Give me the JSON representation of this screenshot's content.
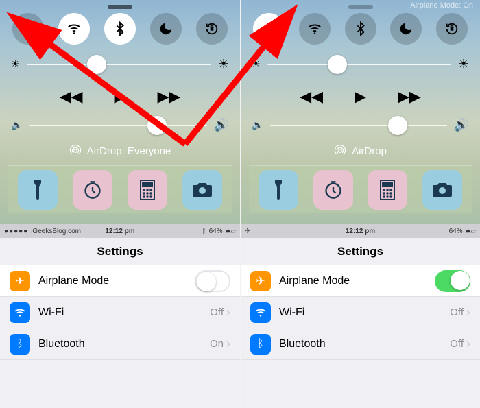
{
  "left": {
    "mode_banner": "",
    "toggles": {
      "airplane_on": false,
      "wifi_on": true,
      "bluetooth_on": true,
      "dnd_on": false,
      "lock_on": false
    },
    "brightness_pct": 38,
    "volume_pct": 72,
    "airdrop_label": "AirDrop: Everyone",
    "statusbar": {
      "carrier": "iGeeksBlog.com",
      "time": "12:12 pm",
      "battery": "64%",
      "airplane_icon": false,
      "show_bt": true
    },
    "settings_title": "Settings",
    "rows": {
      "airplane": {
        "label": "Airplane Mode",
        "switch_on": false
      },
      "wifi": {
        "label": "Wi-Fi",
        "value": "Off"
      },
      "bt": {
        "label": "Bluetooth",
        "value": "On"
      }
    }
  },
  "right": {
    "mode_banner": "Airplane Mode: On",
    "toggles": {
      "airplane_on": true,
      "wifi_on": false,
      "bluetooth_on": false,
      "dnd_on": false,
      "lock_on": false
    },
    "brightness_pct": 38,
    "volume_pct": 72,
    "airdrop_label": "AirDrop",
    "statusbar": {
      "carrier": "",
      "time": "12:12 pm",
      "battery": "64%",
      "airplane_icon": true,
      "show_bt": false
    },
    "settings_title": "Settings",
    "rows": {
      "airplane": {
        "label": "Airplane Mode",
        "switch_on": true
      },
      "wifi": {
        "label": "Wi-Fi",
        "value": "Off"
      },
      "bt": {
        "label": "Bluetooth",
        "value": "Off"
      }
    }
  },
  "icons": {
    "airplane": "airplane-icon",
    "wifi": "wifi-icon",
    "bluetooth": "bluetooth-icon",
    "moon": "moon-icon",
    "rotation_lock": "rotation-lock-icon",
    "sun_small": "brightness-low-icon",
    "sun_large": "brightness-high-icon",
    "rewind": "rewind-icon",
    "play": "play-icon",
    "forward": "forward-icon",
    "speaker_low": "volume-low-icon",
    "speaker_high": "volume-high-icon",
    "airdrop": "airdrop-icon",
    "flashlight": "flashlight-icon",
    "timer": "timer-icon",
    "calculator": "calculator-icon",
    "camera": "camera-icon"
  }
}
